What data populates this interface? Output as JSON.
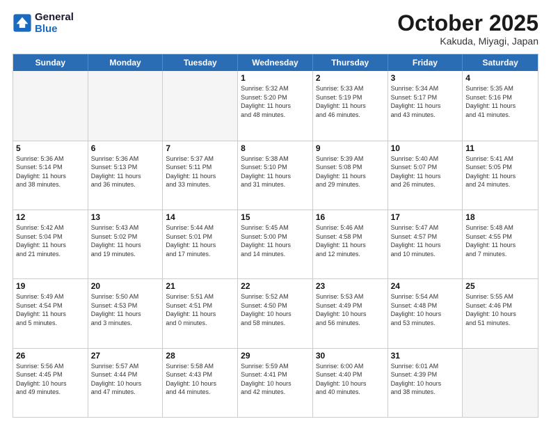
{
  "logo": {
    "line1": "General",
    "line2": "Blue"
  },
  "title": "October 2025",
  "location": "Kakuda, Miyagi, Japan",
  "weekdays": [
    "Sunday",
    "Monday",
    "Tuesday",
    "Wednesday",
    "Thursday",
    "Friday",
    "Saturday"
  ],
  "weeks": [
    [
      {
        "day": "",
        "info": ""
      },
      {
        "day": "",
        "info": ""
      },
      {
        "day": "",
        "info": ""
      },
      {
        "day": "1",
        "info": "Sunrise: 5:32 AM\nSunset: 5:20 PM\nDaylight: 11 hours\nand 48 minutes."
      },
      {
        "day": "2",
        "info": "Sunrise: 5:33 AM\nSunset: 5:19 PM\nDaylight: 11 hours\nand 46 minutes."
      },
      {
        "day": "3",
        "info": "Sunrise: 5:34 AM\nSunset: 5:17 PM\nDaylight: 11 hours\nand 43 minutes."
      },
      {
        "day": "4",
        "info": "Sunrise: 5:35 AM\nSunset: 5:16 PM\nDaylight: 11 hours\nand 41 minutes."
      }
    ],
    [
      {
        "day": "5",
        "info": "Sunrise: 5:36 AM\nSunset: 5:14 PM\nDaylight: 11 hours\nand 38 minutes."
      },
      {
        "day": "6",
        "info": "Sunrise: 5:36 AM\nSunset: 5:13 PM\nDaylight: 11 hours\nand 36 minutes."
      },
      {
        "day": "7",
        "info": "Sunrise: 5:37 AM\nSunset: 5:11 PM\nDaylight: 11 hours\nand 33 minutes."
      },
      {
        "day": "8",
        "info": "Sunrise: 5:38 AM\nSunset: 5:10 PM\nDaylight: 11 hours\nand 31 minutes."
      },
      {
        "day": "9",
        "info": "Sunrise: 5:39 AM\nSunset: 5:08 PM\nDaylight: 11 hours\nand 29 minutes."
      },
      {
        "day": "10",
        "info": "Sunrise: 5:40 AM\nSunset: 5:07 PM\nDaylight: 11 hours\nand 26 minutes."
      },
      {
        "day": "11",
        "info": "Sunrise: 5:41 AM\nSunset: 5:05 PM\nDaylight: 11 hours\nand 24 minutes."
      }
    ],
    [
      {
        "day": "12",
        "info": "Sunrise: 5:42 AM\nSunset: 5:04 PM\nDaylight: 11 hours\nand 21 minutes."
      },
      {
        "day": "13",
        "info": "Sunrise: 5:43 AM\nSunset: 5:02 PM\nDaylight: 11 hours\nand 19 minutes."
      },
      {
        "day": "14",
        "info": "Sunrise: 5:44 AM\nSunset: 5:01 PM\nDaylight: 11 hours\nand 17 minutes."
      },
      {
        "day": "15",
        "info": "Sunrise: 5:45 AM\nSunset: 5:00 PM\nDaylight: 11 hours\nand 14 minutes."
      },
      {
        "day": "16",
        "info": "Sunrise: 5:46 AM\nSunset: 4:58 PM\nDaylight: 11 hours\nand 12 minutes."
      },
      {
        "day": "17",
        "info": "Sunrise: 5:47 AM\nSunset: 4:57 PM\nDaylight: 11 hours\nand 10 minutes."
      },
      {
        "day": "18",
        "info": "Sunrise: 5:48 AM\nSunset: 4:55 PM\nDaylight: 11 hours\nand 7 minutes."
      }
    ],
    [
      {
        "day": "19",
        "info": "Sunrise: 5:49 AM\nSunset: 4:54 PM\nDaylight: 11 hours\nand 5 minutes."
      },
      {
        "day": "20",
        "info": "Sunrise: 5:50 AM\nSunset: 4:53 PM\nDaylight: 11 hours\nand 3 minutes."
      },
      {
        "day": "21",
        "info": "Sunrise: 5:51 AM\nSunset: 4:51 PM\nDaylight: 11 hours\nand 0 minutes."
      },
      {
        "day": "22",
        "info": "Sunrise: 5:52 AM\nSunset: 4:50 PM\nDaylight: 10 hours\nand 58 minutes."
      },
      {
        "day": "23",
        "info": "Sunrise: 5:53 AM\nSunset: 4:49 PM\nDaylight: 10 hours\nand 56 minutes."
      },
      {
        "day": "24",
        "info": "Sunrise: 5:54 AM\nSunset: 4:48 PM\nDaylight: 10 hours\nand 53 minutes."
      },
      {
        "day": "25",
        "info": "Sunrise: 5:55 AM\nSunset: 4:46 PM\nDaylight: 10 hours\nand 51 minutes."
      }
    ],
    [
      {
        "day": "26",
        "info": "Sunrise: 5:56 AM\nSunset: 4:45 PM\nDaylight: 10 hours\nand 49 minutes."
      },
      {
        "day": "27",
        "info": "Sunrise: 5:57 AM\nSunset: 4:44 PM\nDaylight: 10 hours\nand 47 minutes."
      },
      {
        "day": "28",
        "info": "Sunrise: 5:58 AM\nSunset: 4:43 PM\nDaylight: 10 hours\nand 44 minutes."
      },
      {
        "day": "29",
        "info": "Sunrise: 5:59 AM\nSunset: 4:41 PM\nDaylight: 10 hours\nand 42 minutes."
      },
      {
        "day": "30",
        "info": "Sunrise: 6:00 AM\nSunset: 4:40 PM\nDaylight: 10 hours\nand 40 minutes."
      },
      {
        "day": "31",
        "info": "Sunrise: 6:01 AM\nSunset: 4:39 PM\nDaylight: 10 hours\nand 38 minutes."
      },
      {
        "day": "",
        "info": ""
      }
    ]
  ]
}
